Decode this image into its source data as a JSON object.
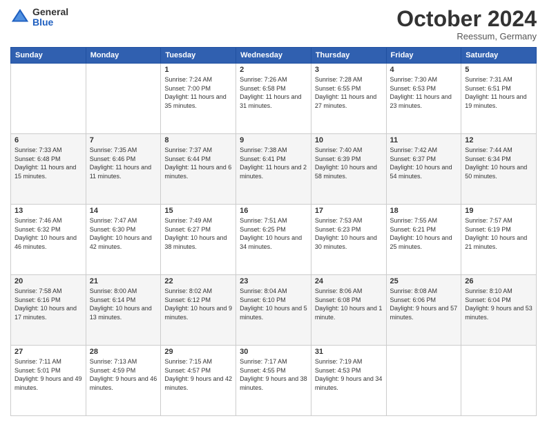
{
  "logo": {
    "general": "General",
    "blue": "Blue"
  },
  "title": "October 2024",
  "location": "Reessum, Germany",
  "days_of_week": [
    "Sunday",
    "Monday",
    "Tuesday",
    "Wednesday",
    "Thursday",
    "Friday",
    "Saturday"
  ],
  "weeks": [
    [
      {
        "day": "",
        "sunrise": "",
        "sunset": "",
        "daylight": ""
      },
      {
        "day": "",
        "sunrise": "",
        "sunset": "",
        "daylight": ""
      },
      {
        "day": "1",
        "sunrise": "Sunrise: 7:24 AM",
        "sunset": "Sunset: 7:00 PM",
        "daylight": "Daylight: 11 hours and 35 minutes."
      },
      {
        "day": "2",
        "sunrise": "Sunrise: 7:26 AM",
        "sunset": "Sunset: 6:58 PM",
        "daylight": "Daylight: 11 hours and 31 minutes."
      },
      {
        "day": "3",
        "sunrise": "Sunrise: 7:28 AM",
        "sunset": "Sunset: 6:55 PM",
        "daylight": "Daylight: 11 hours and 27 minutes."
      },
      {
        "day": "4",
        "sunrise": "Sunrise: 7:30 AM",
        "sunset": "Sunset: 6:53 PM",
        "daylight": "Daylight: 11 hours and 23 minutes."
      },
      {
        "day": "5",
        "sunrise": "Sunrise: 7:31 AM",
        "sunset": "Sunset: 6:51 PM",
        "daylight": "Daylight: 11 hours and 19 minutes."
      }
    ],
    [
      {
        "day": "6",
        "sunrise": "Sunrise: 7:33 AM",
        "sunset": "Sunset: 6:48 PM",
        "daylight": "Daylight: 11 hours and 15 minutes."
      },
      {
        "day": "7",
        "sunrise": "Sunrise: 7:35 AM",
        "sunset": "Sunset: 6:46 PM",
        "daylight": "Daylight: 11 hours and 11 minutes."
      },
      {
        "day": "8",
        "sunrise": "Sunrise: 7:37 AM",
        "sunset": "Sunset: 6:44 PM",
        "daylight": "Daylight: 11 hours and 6 minutes."
      },
      {
        "day": "9",
        "sunrise": "Sunrise: 7:38 AM",
        "sunset": "Sunset: 6:41 PM",
        "daylight": "Daylight: 11 hours and 2 minutes."
      },
      {
        "day": "10",
        "sunrise": "Sunrise: 7:40 AM",
        "sunset": "Sunset: 6:39 PM",
        "daylight": "Daylight: 10 hours and 58 minutes."
      },
      {
        "day": "11",
        "sunrise": "Sunrise: 7:42 AM",
        "sunset": "Sunset: 6:37 PM",
        "daylight": "Daylight: 10 hours and 54 minutes."
      },
      {
        "day": "12",
        "sunrise": "Sunrise: 7:44 AM",
        "sunset": "Sunset: 6:34 PM",
        "daylight": "Daylight: 10 hours and 50 minutes."
      }
    ],
    [
      {
        "day": "13",
        "sunrise": "Sunrise: 7:46 AM",
        "sunset": "Sunset: 6:32 PM",
        "daylight": "Daylight: 10 hours and 46 minutes."
      },
      {
        "day": "14",
        "sunrise": "Sunrise: 7:47 AM",
        "sunset": "Sunset: 6:30 PM",
        "daylight": "Daylight: 10 hours and 42 minutes."
      },
      {
        "day": "15",
        "sunrise": "Sunrise: 7:49 AM",
        "sunset": "Sunset: 6:27 PM",
        "daylight": "Daylight: 10 hours and 38 minutes."
      },
      {
        "day": "16",
        "sunrise": "Sunrise: 7:51 AM",
        "sunset": "Sunset: 6:25 PM",
        "daylight": "Daylight: 10 hours and 34 minutes."
      },
      {
        "day": "17",
        "sunrise": "Sunrise: 7:53 AM",
        "sunset": "Sunset: 6:23 PM",
        "daylight": "Daylight: 10 hours and 30 minutes."
      },
      {
        "day": "18",
        "sunrise": "Sunrise: 7:55 AM",
        "sunset": "Sunset: 6:21 PM",
        "daylight": "Daylight: 10 hours and 25 minutes."
      },
      {
        "day": "19",
        "sunrise": "Sunrise: 7:57 AM",
        "sunset": "Sunset: 6:19 PM",
        "daylight": "Daylight: 10 hours and 21 minutes."
      }
    ],
    [
      {
        "day": "20",
        "sunrise": "Sunrise: 7:58 AM",
        "sunset": "Sunset: 6:16 PM",
        "daylight": "Daylight: 10 hours and 17 minutes."
      },
      {
        "day": "21",
        "sunrise": "Sunrise: 8:00 AM",
        "sunset": "Sunset: 6:14 PM",
        "daylight": "Daylight: 10 hours and 13 minutes."
      },
      {
        "day": "22",
        "sunrise": "Sunrise: 8:02 AM",
        "sunset": "Sunset: 6:12 PM",
        "daylight": "Daylight: 10 hours and 9 minutes."
      },
      {
        "day": "23",
        "sunrise": "Sunrise: 8:04 AM",
        "sunset": "Sunset: 6:10 PM",
        "daylight": "Daylight: 10 hours and 5 minutes."
      },
      {
        "day": "24",
        "sunrise": "Sunrise: 8:06 AM",
        "sunset": "Sunset: 6:08 PM",
        "daylight": "Daylight: 10 hours and 1 minute."
      },
      {
        "day": "25",
        "sunrise": "Sunrise: 8:08 AM",
        "sunset": "Sunset: 6:06 PM",
        "daylight": "Daylight: 9 hours and 57 minutes."
      },
      {
        "day": "26",
        "sunrise": "Sunrise: 8:10 AM",
        "sunset": "Sunset: 6:04 PM",
        "daylight": "Daylight: 9 hours and 53 minutes."
      }
    ],
    [
      {
        "day": "27",
        "sunrise": "Sunrise: 7:11 AM",
        "sunset": "Sunset: 5:01 PM",
        "daylight": "Daylight: 9 hours and 49 minutes."
      },
      {
        "day": "28",
        "sunrise": "Sunrise: 7:13 AM",
        "sunset": "Sunset: 4:59 PM",
        "daylight": "Daylight: 9 hours and 46 minutes."
      },
      {
        "day": "29",
        "sunrise": "Sunrise: 7:15 AM",
        "sunset": "Sunset: 4:57 PM",
        "daylight": "Daylight: 9 hours and 42 minutes."
      },
      {
        "day": "30",
        "sunrise": "Sunrise: 7:17 AM",
        "sunset": "Sunset: 4:55 PM",
        "daylight": "Daylight: 9 hours and 38 minutes."
      },
      {
        "day": "31",
        "sunrise": "Sunrise: 7:19 AM",
        "sunset": "Sunset: 4:53 PM",
        "daylight": "Daylight: 9 hours and 34 minutes."
      },
      {
        "day": "",
        "sunrise": "",
        "sunset": "",
        "daylight": ""
      },
      {
        "day": "",
        "sunrise": "",
        "sunset": "",
        "daylight": ""
      }
    ]
  ]
}
